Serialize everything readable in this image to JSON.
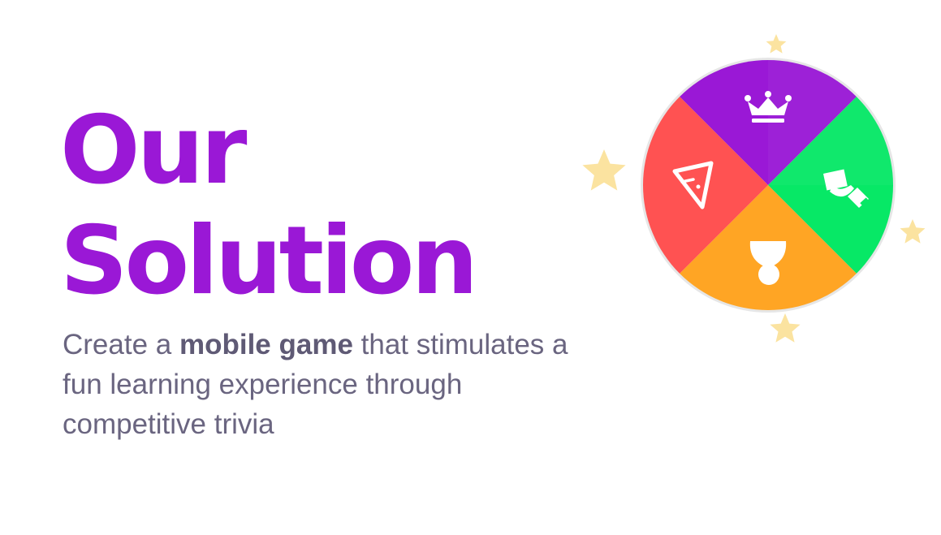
{
  "heading": {
    "line1": "Our",
    "line2": "Solution"
  },
  "description": {
    "text_before": "Create a ",
    "emphasis": "mobile game",
    "text_after": " that stimulates a fun learning experience through competitive trivia"
  },
  "wheel": {
    "segments": [
      {
        "name": "top",
        "color": "#9a18d6",
        "icon": "crown-icon"
      },
      {
        "name": "right",
        "color": "#07e866",
        "icon": "hand-card-icon"
      },
      {
        "name": "bottom",
        "color": "#ffa524",
        "icon": "exclamation-icon"
      },
      {
        "name": "left",
        "color": "#ff5252",
        "icon": "warning-triangle-icon"
      }
    ],
    "star_color": "#fbe3a0"
  },
  "colors": {
    "heading": "#9a18d6",
    "body_text": "#6a6580",
    "background": "#ffffff"
  }
}
